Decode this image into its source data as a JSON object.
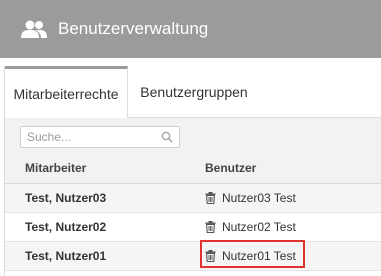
{
  "header": {
    "title": "Benutzerverwaltung",
    "icon": "users-icon"
  },
  "tabs": [
    {
      "label": "Mitarbeiterrechte",
      "active": true
    },
    {
      "label": "Benutzergruppen",
      "active": false
    }
  ],
  "search": {
    "placeholder": "Suche...",
    "value": "",
    "icon": "search-icon"
  },
  "table": {
    "columns": [
      "Mitarbeiter",
      "Benutzer"
    ],
    "rows": [
      {
        "employee": "Test, Nutzer03",
        "user": "Nutzer03 Test",
        "icon": "trash-icon"
      },
      {
        "employee": "Test, Nutzer02",
        "user": "Nutzer02 Test",
        "icon": "trash-icon"
      },
      {
        "employee": "Test, Nutzer01",
        "user": "Nutzer01 Test",
        "icon": "trash-icon",
        "highlighted": true
      }
    ]
  },
  "colors": {
    "header_bg": "#9b9b9b",
    "highlight": "#e0322f",
    "toolbar_bg": "#f2f2f2"
  }
}
